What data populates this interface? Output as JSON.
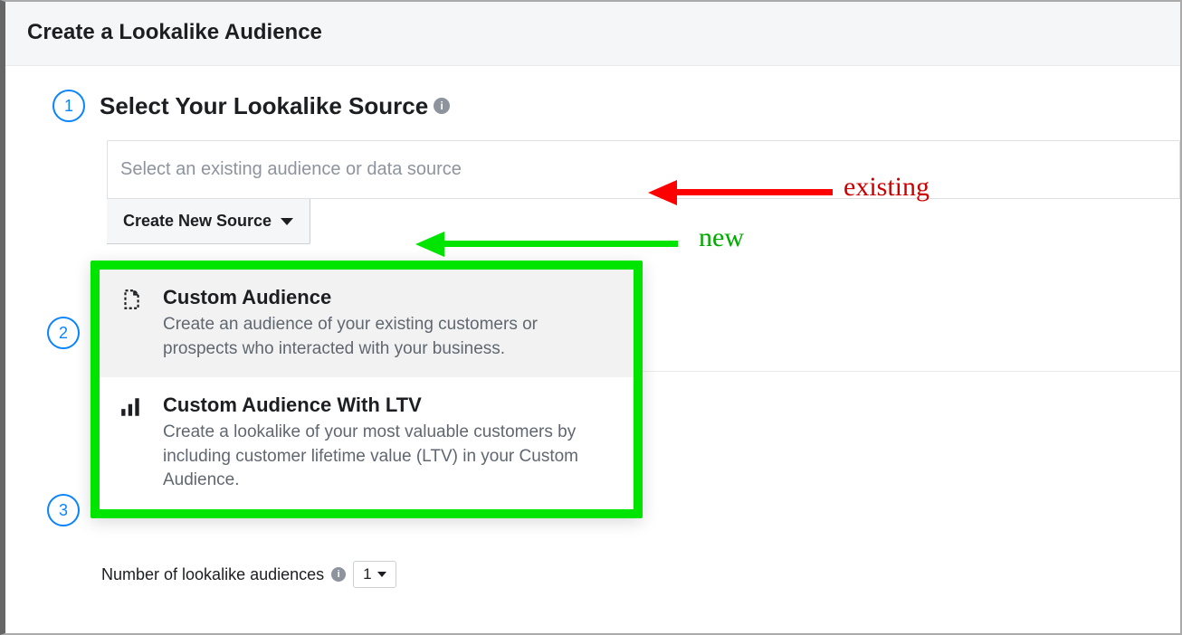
{
  "header": {
    "title": "Create a Lookalike Audience"
  },
  "step1": {
    "number": "1",
    "title": "Select Your Lookalike Source",
    "input_placeholder": "Select an existing audience or data source",
    "create_new_label": "Create New Source"
  },
  "dropdown": {
    "items": [
      {
        "title": "Custom Audience",
        "desc": "Create an audience of your existing customers or prospects who interacted with your business."
      },
      {
        "title": "Custom Audience With LTV",
        "desc": "Create a lookalike of your most valuable customers by including customer lifetime value (LTV) in your Custom Audience."
      }
    ]
  },
  "step2": {
    "number": "2"
  },
  "step3": {
    "number": "3",
    "numline_label": "Number of lookalike audiences",
    "num_value": "1"
  },
  "annotations": {
    "existing": "existing",
    "new": "new",
    "colors": {
      "red": "#ff0000",
      "green": "#00e500"
    }
  }
}
